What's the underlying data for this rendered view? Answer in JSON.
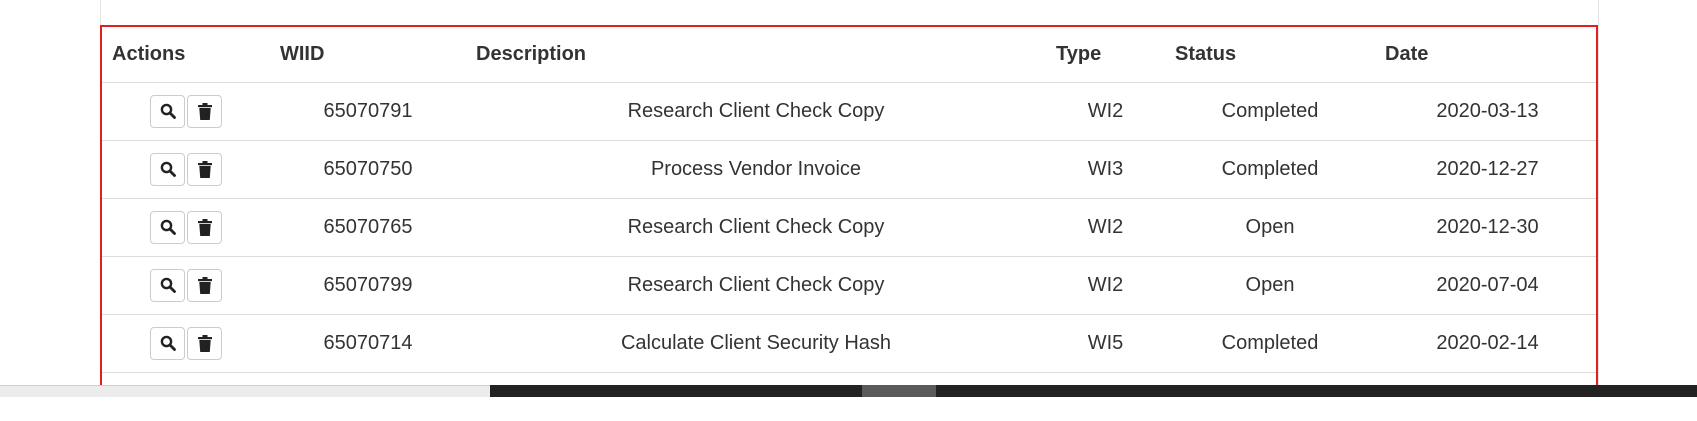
{
  "table": {
    "headers": [
      "Actions",
      "WIID",
      "Description",
      "Type",
      "Status",
      "Date"
    ],
    "rows": [
      {
        "wiid": "65070791",
        "description": "Research Client Check Copy",
        "type": "WI2",
        "status": "Completed",
        "date": "2020-03-13"
      },
      {
        "wiid": "65070750",
        "description": "Process Vendor Invoice",
        "type": "WI3",
        "status": "Completed",
        "date": "2020-12-27"
      },
      {
        "wiid": "65070765",
        "description": "Research Client Check Copy",
        "type": "WI2",
        "status": "Open",
        "date": "2020-12-30"
      },
      {
        "wiid": "65070799",
        "description": "Research Client Check Copy",
        "type": "WI2",
        "status": "Open",
        "date": "2020-07-04"
      },
      {
        "wiid": "65070714",
        "description": "Calculate Client Security Hash",
        "type": "WI5",
        "status": "Completed",
        "date": "2020-02-14"
      }
    ]
  },
  "icons": {
    "view": "search-icon",
    "delete": "trash-icon"
  },
  "colors": {
    "highlight_border": "#e02020",
    "text": "#333333",
    "row_divider": "#dddddd"
  }
}
